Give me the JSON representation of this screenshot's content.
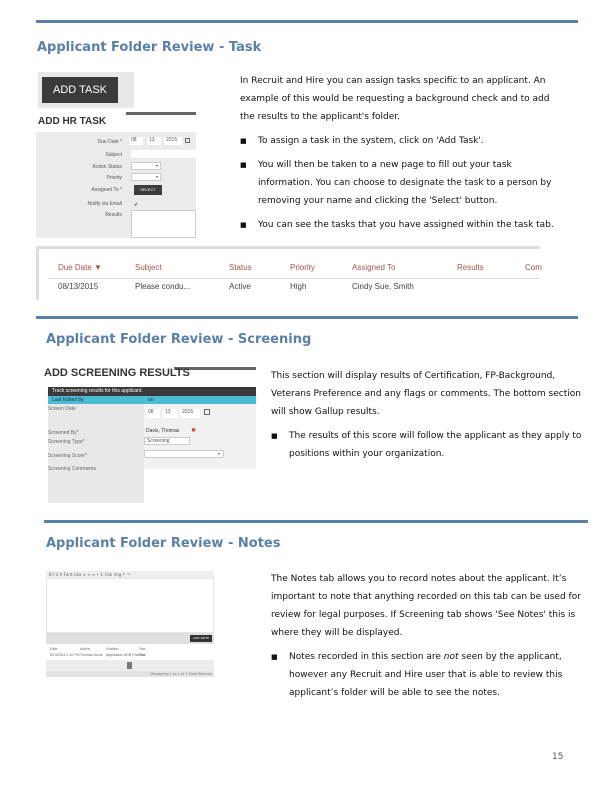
{
  "sections": {
    "task": {
      "title": "Applicant Folder Review - Task",
      "intro": "In Recruit and Hire you can assign tasks specific to an applicant.  An example of this would be requesting a background check and to add the results to the applicant's folder.",
      "bullets": [
        "To assign a task in the system, click on 'Add Task'.",
        "You will then be taken to a new page to fill out your task information.  You can choose to designate the task to a person by removing your name and clicking the 'Select' button.",
        "You can see the tasks that you have assigned within the task tab."
      ],
      "add_task_button": "ADD TASK",
      "form": {
        "title": "ADD HR TASK",
        "fields": {
          "due_date_label": "Due Date *",
          "due_month": "08",
          "due_day": "13",
          "due_year": "2015",
          "subject_label": "Subject",
          "action_status_label": "Action Status",
          "priority_label": "Priority",
          "assigned_to_label": "Assigned To *",
          "select_button": "SELECT",
          "notify_label": "Notify via Email",
          "results_label": "Results"
        }
      },
      "table": {
        "headers": [
          "Due Date ▼",
          "Subject",
          "Status",
          "Priority",
          "Assigned To",
          "Results",
          "Com"
        ],
        "rows": [
          [
            "08/13/2015",
            "Please condu...",
            "Active",
            "High",
            "Cindy Sue, Smith",
            "",
            ""
          ]
        ]
      }
    },
    "screening": {
      "title": "Applicant Folder Review - Screening",
      "intro": "This section will display results of Certification, FP-Background, Veterans Preference and any flags or comments. The bottom section will show Gallup results.",
      "bullets": [
        "The results of this score will follow the applicant as they apply to positions within your organization."
      ],
      "form": {
        "title": "ADD SCREENING RESULTS",
        "subtitle": "Track screening results for this applicant.",
        "last_edited_label": "Last Edited by",
        "last_edited_value": "on",
        "screen_date_label": "Screen Date",
        "date_month": "08",
        "date_day": "13",
        "date_year": "2015",
        "screened_by_label": "Screened By*",
        "screened_by_value": "Davis, Thomas",
        "screening_type_label": "Screening Type*",
        "screening_type_value": "Screening",
        "screening_score_label": "Screening Score*",
        "screening_comments_label": "Screening Comments"
      }
    },
    "notes": {
      "title": "Applicant Folder Review - Notes",
      "intro": "The Notes tab allows you to record notes about the applicant.  It’s important to note that anything recorded on this tab can be used for review for legal purposes.  If Screening tab shows 'See Notes' this is where they will be displayed.",
      "bullet_pre": "Notes recorded in this section are ",
      "bullet_em": "not",
      "bullet_post": " seen by the applicant, however any Recruit and Hire user that is able to review this applicant’s folder will be able to see the notes.",
      "widget": {
        "toolbar": "B I U A  Font size   ≡ ≡ ≡  • 1.  link img  ↶ ↷",
        "add_note_button": "ADD NOTE",
        "grid_headers": [
          "Date",
          "Author",
          "Position",
          "Text"
        ],
        "grid_row": [
          "8/13/2015 1:10 PM",
          "Thomas Davis",
          "Application ARR Position",
          "Test"
        ],
        "footer": "Displaying 1 to 1 of 1 Total Records"
      }
    }
  },
  "page_number": "15"
}
